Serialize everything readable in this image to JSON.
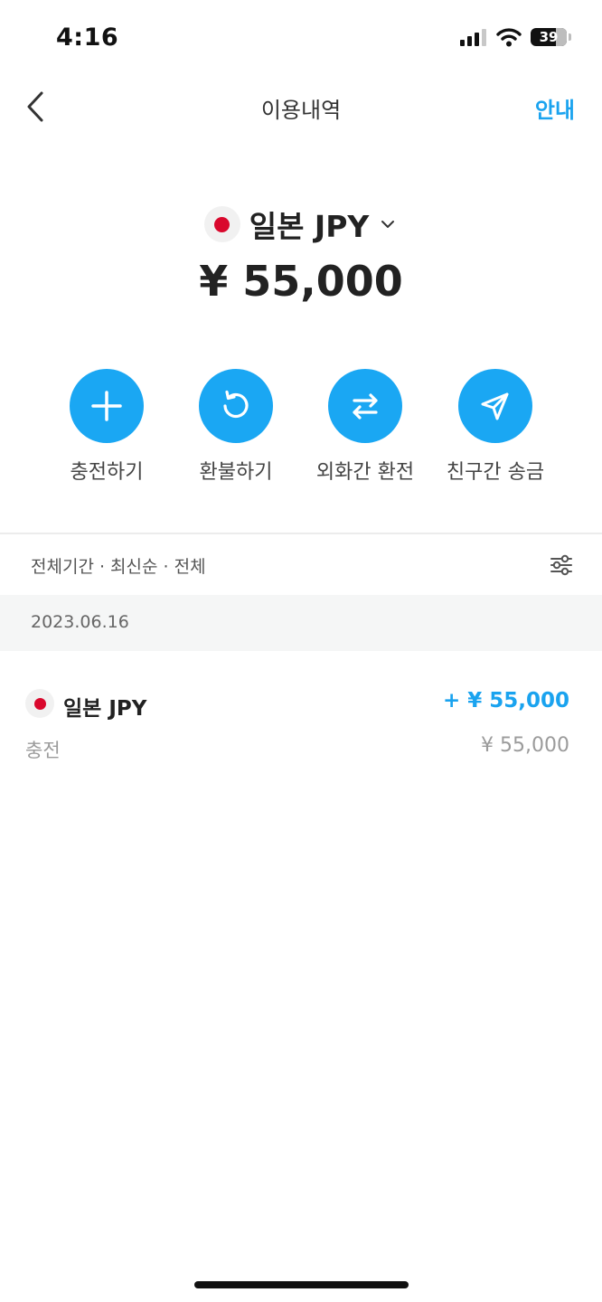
{
  "status": {
    "time": "4:16",
    "battery": "39"
  },
  "nav": {
    "title": "이용내역",
    "guide": "안내"
  },
  "currency": {
    "name": "일본 JPY",
    "balance": "¥ 55,000",
    "flag_color": "#d9082d"
  },
  "actions": [
    {
      "label": "충전하기",
      "icon": "plus-icon"
    },
    {
      "label": "환불하기",
      "icon": "refresh-icon"
    },
    {
      "label": "외화간 환전",
      "icon": "swap-icon"
    },
    {
      "label": "친구간 송금",
      "icon": "send-icon"
    }
  ],
  "filter": {
    "text": "전체기간 · 최신순 · 전체"
  },
  "groups": [
    {
      "date": "2023.06.16",
      "transactions": [
        {
          "currency": "일본 JPY",
          "amount": "+ ¥ 55,000",
          "type": "충전",
          "sub_amount": "¥ 55,000"
        }
      ]
    }
  ],
  "colors": {
    "accent": "#1aa7f3",
    "divider": "#ececec",
    "date_bg": "#f5f6f6"
  }
}
